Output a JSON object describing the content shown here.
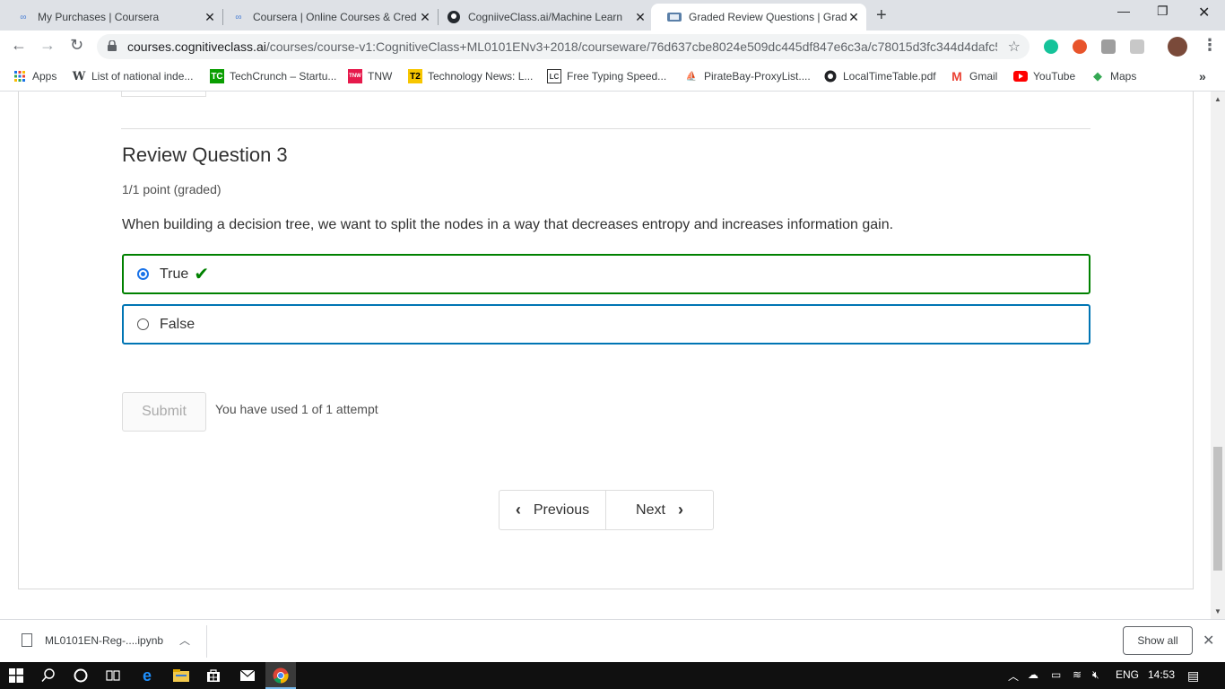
{
  "browser": {
    "tabs": [
      {
        "label": "My Purchases | Coursera",
        "icon": "coursera-icon"
      },
      {
        "label": "Coursera | Online Courses & Cred",
        "icon": "coursera-icon"
      },
      {
        "label": "CogniiveClass.ai/Machine Learn",
        "icon": "github-icon"
      },
      {
        "label": "Graded Review Questions | Grade",
        "icon": "cognitiveclass-icon"
      }
    ],
    "new_tab_label": "+",
    "url_host": "courses.cognitiveclass.ai",
    "url_path": "/courses/course-v1:CognitiveClass+ML0101ENv3+2018/courseware/76d637cbe8024e509dc445df847e6c3a/c78015d3fc344d4dafc5...",
    "bookmarks": [
      {
        "label": "Apps"
      },
      {
        "label": "List of national inde..."
      },
      {
        "label": "TechCrunch – Startu..."
      },
      {
        "label": "TNW"
      },
      {
        "label": "Technology News: L..."
      },
      {
        "label": "Free Typing Speed..."
      },
      {
        "label": "PirateBay-ProxyList...."
      },
      {
        "label": "LocalTimeTable.pdf"
      },
      {
        "label": "Gmail"
      },
      {
        "label": "YouTube"
      },
      {
        "label": "Maps"
      }
    ],
    "bookmarks_more": "»"
  },
  "question": {
    "title": "Review Question 3",
    "points": "1/1 point (graded)",
    "text": "When building a decision tree, we want to split the nodes in a way that decreases entropy and increases information gain.",
    "options": [
      {
        "label": "True",
        "selected": true,
        "correct": true
      },
      {
        "label": "False",
        "selected": false
      }
    ],
    "submit_label": "Submit",
    "attempts_text": "You have used 1 of 1 attempt"
  },
  "sequence_nav": {
    "previous_label": "Previous",
    "next_label": "Next"
  },
  "downloads": {
    "file_name": "ML0101EN-Reg-....ipynb",
    "show_all_label": "Show all"
  },
  "taskbar": {
    "language": "ENG",
    "time": "14:53"
  },
  "colors": {
    "correct_border": "#008100",
    "option_border": "#0075b4",
    "radio_selected": "#1a73e8"
  }
}
